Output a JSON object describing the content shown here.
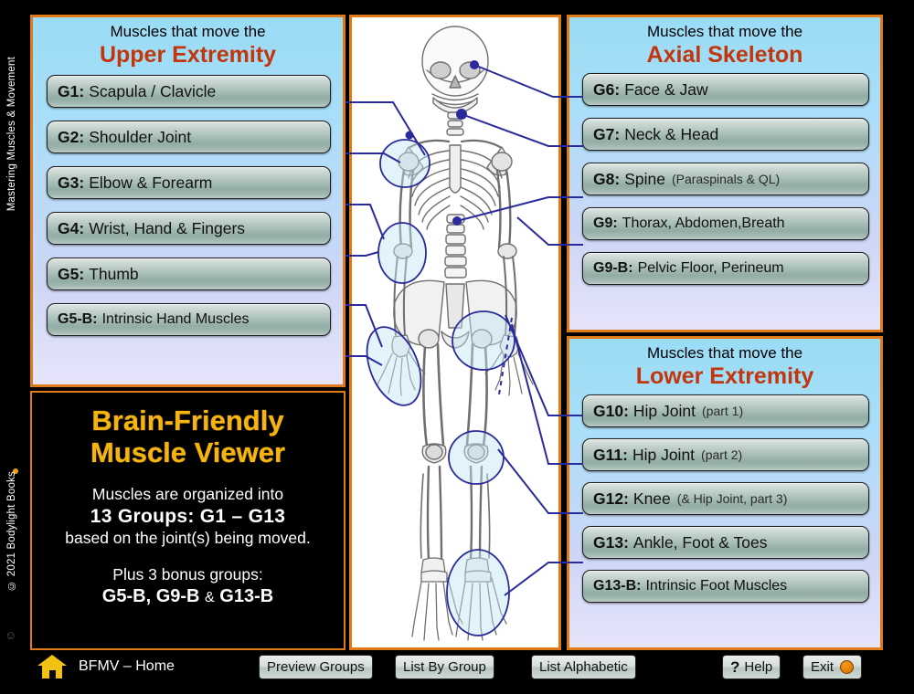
{
  "rail": {
    "top_text": "Mastering Muscles & Movement",
    "bottom_text": "© 2021 Bodylight Books",
    "dot_color": "#f0a010"
  },
  "colors": {
    "panel_border": "#e07a18",
    "accent_heading": "#c3350a",
    "title_gold": "#f5b40f",
    "connector": "#2a2a9a",
    "background": "#000000"
  },
  "panels": {
    "upper": {
      "title_line1": "Muscles that move the",
      "title_accent": "Upper Extremity",
      "groups": [
        {
          "id": "G1:",
          "name": "Scapula / Clavicle",
          "sub": ""
        },
        {
          "id": "G2:",
          "name": "Shoulder Joint",
          "sub": ""
        },
        {
          "id": "G3:",
          "name": "Elbow & Forearm",
          "sub": ""
        },
        {
          "id": "G4:",
          "name": "Wrist, Hand & Fingers",
          "sub": ""
        },
        {
          "id": "G5:",
          "name": "Thumb",
          "sub": ""
        },
        {
          "id": "G5-B:",
          "name": "Intrinsic Hand Muscles",
          "sub": ""
        }
      ]
    },
    "axial": {
      "title_line1": "Muscles that move the",
      "title_accent": "Axial Skeleton",
      "groups": [
        {
          "id": "G6:",
          "name": "Face & Jaw",
          "sub": ""
        },
        {
          "id": "G7:",
          "name": "Neck & Head",
          "sub": ""
        },
        {
          "id": "G8:",
          "name": "Spine",
          "sub": "(Paraspinals & QL)"
        },
        {
          "id": "G9:",
          "name": "Thorax, Abdomen,Breath",
          "sub": ""
        },
        {
          "id": "G9-B:",
          "name": "Pelvic Floor, Perineum",
          "sub": ""
        }
      ]
    },
    "lower": {
      "title_line1": "Muscles that move the",
      "title_accent": "Lower Extremity",
      "groups": [
        {
          "id": "G10:",
          "name": "Hip Joint",
          "sub": "(part 1)"
        },
        {
          "id": "G11:",
          "name": "Hip Joint",
          "sub": "(part 2)"
        },
        {
          "id": "G12:",
          "name": "Knee",
          "sub": "(& Hip Joint, part 3)"
        },
        {
          "id": "G13:",
          "name": "Ankle, Foot & Toes",
          "sub": ""
        },
        {
          "id": "G13-B:",
          "name": "Intrinsic Foot Muscles",
          "sub": ""
        }
      ]
    }
  },
  "infobox": {
    "title_line1": "Brain-Friendly",
    "title_line2": "Muscle Viewer",
    "line1": "Muscles are organized into",
    "line2": "13 Groups: G1 – G13",
    "line3": "based on the joint(s) being moved.",
    "line4": "Plus 3 bonus groups:",
    "line5_a": "G5-B, G9-B",
    "line5_amp": "&",
    "line5_b": "G13-B"
  },
  "bottombar": {
    "home_label": "BFMV –  Home",
    "preview_label": "Preview Groups",
    "bygroup_label": "List By Group",
    "alphabetic_label": "List Alphabetic",
    "help_mark": "?",
    "help_label": "Help",
    "exit_label": "Exit",
    "smiley": "☺"
  }
}
